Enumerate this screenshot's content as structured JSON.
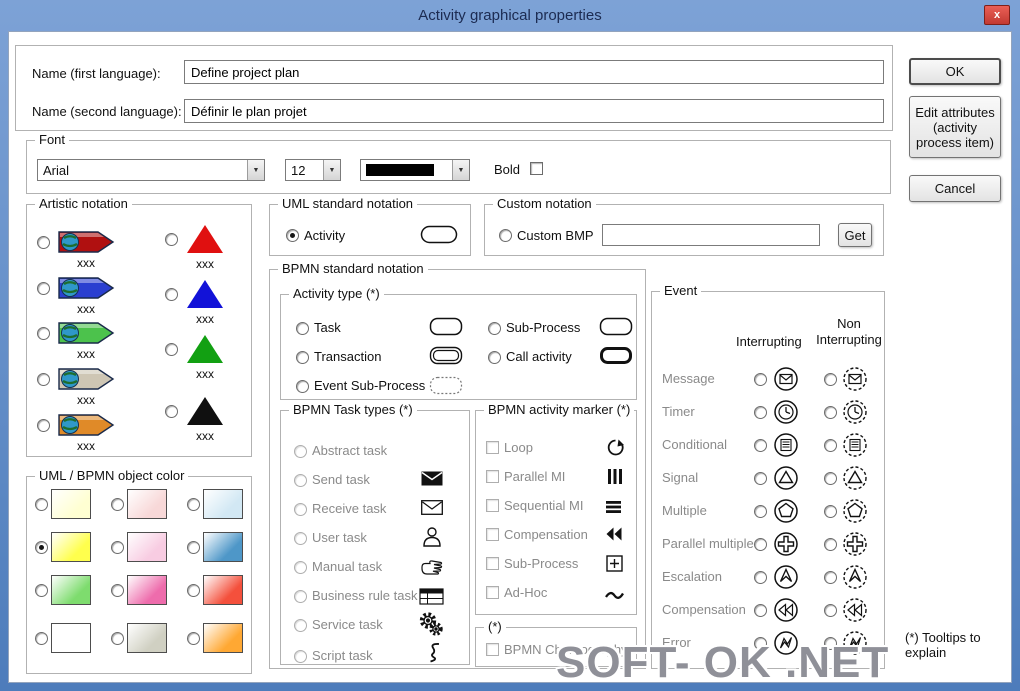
{
  "window": {
    "title": "Activity graphical properties",
    "close": "x"
  },
  "names": {
    "first_label": "Name (first language):",
    "first_value": "Define project plan",
    "second_label": "Name (second language):",
    "second_value": "Définir le plan projet"
  },
  "font": {
    "group": "Font",
    "family": "Arial",
    "size": "12",
    "color": "#000000",
    "bold_label": "Bold"
  },
  "actions": {
    "ok": "OK",
    "edit": "Edit attributes (activity process item)",
    "cancel": "Cancel"
  },
  "artistic": {
    "group": "Artistic notation",
    "arrows": [
      {
        "label": "xxx",
        "color": "#b01010",
        "icon": "globe-arrow-red"
      },
      {
        "label": "xxx",
        "color": "#2a3fd0",
        "icon": "globe-arrow-blue"
      },
      {
        "label": "xxx",
        "color": "#4cc24c",
        "icon": "globe-arrow-green"
      },
      {
        "label": "xxx",
        "color": "#cec6b4",
        "icon": "globe-arrow-tan"
      },
      {
        "label": "xxx",
        "color": "#e08a28",
        "icon": "globe-arrow-orange"
      }
    ],
    "triangles": [
      {
        "label": "xxx",
        "color": "#e01010",
        "icon": "triangle-red"
      },
      {
        "label": "xxx",
        "color": "#1212d8",
        "icon": "triangle-blue"
      },
      {
        "label": "xxx",
        "color": "#12a012",
        "icon": "triangle-green"
      },
      {
        "label": "xxx",
        "color": "#101010",
        "icon": "triangle-black"
      }
    ]
  },
  "object_color": {
    "group": "UML / BPMN object color",
    "selected_index": 3,
    "swatches": [
      "#ffffd2",
      "#f8d8d8",
      "#d2e8f4",
      "#ffff4d",
      "#f8cce2",
      "#4e97c8",
      "#7edc6e",
      "#ee6cac",
      "#f4503c",
      "#ffffff",
      "#d0d0c2",
      "#ffa833"
    ]
  },
  "uml": {
    "group": "UML standard notation",
    "activity_label": "Activity"
  },
  "custom": {
    "group": "Custom notation",
    "bmp_label": "Custom BMP",
    "bmp_value": "",
    "get_label": "Get"
  },
  "bpmn": {
    "group": "BPMN standard notation",
    "activity_type": {
      "group": "Activity type (*)",
      "left": [
        "Task",
        "Transaction",
        "Event Sub-Process"
      ],
      "right": [
        "Sub-Process",
        "Call activity"
      ]
    },
    "task_types": {
      "group": "BPMN Task types (*)",
      "items": [
        {
          "label": "Abstract task",
          "icon": "none"
        },
        {
          "label": "Send task",
          "icon": "envelope-filled"
        },
        {
          "label": "Receive task",
          "icon": "envelope-outline"
        },
        {
          "label": "User task",
          "icon": "person"
        },
        {
          "label": "Manual task",
          "icon": "hand"
        },
        {
          "label": "Business rule task",
          "icon": "table"
        },
        {
          "label": "Service task",
          "icon": "gears"
        },
        {
          "label": "Script task",
          "icon": "script"
        }
      ]
    },
    "markers": {
      "group": "BPMN activity marker (*)",
      "items": [
        {
          "label": "Loop",
          "icon": "loop-arrow"
        },
        {
          "label": "Parallel MI",
          "icon": "vertical-bars"
        },
        {
          "label": "Sequential MI",
          "icon": "horizontal-bars"
        },
        {
          "label": "Compensation",
          "icon": "rewind"
        },
        {
          "label": "Sub-Process",
          "icon": "boxed-plus"
        },
        {
          "label": "Ad-Hoc",
          "icon": "wave"
        }
      ]
    },
    "choreography": {
      "group": "(*)",
      "label": "BPMN Choreography?"
    }
  },
  "event": {
    "group": "Event",
    "columns": {
      "interrupting": "Interrupting",
      "non_interrupting": "Non Interrupting"
    },
    "rows": [
      {
        "label": "Message",
        "icon": "envelope"
      },
      {
        "label": "Timer",
        "icon": "clock"
      },
      {
        "label": "Conditional",
        "icon": "lined-page"
      },
      {
        "label": "Signal",
        "icon": "triangle"
      },
      {
        "label": "Multiple",
        "icon": "pentagon"
      },
      {
        "label": "Parallel multiple",
        "icon": "plus"
      },
      {
        "label": "Escalation",
        "icon": "escalation-arrow"
      },
      {
        "label": "Compensation",
        "icon": "rewind"
      },
      {
        "label": "Error",
        "icon": "lightning"
      }
    ]
  },
  "footnote": "(*) Tooltips to explain",
  "watermark": "SOFT- OK .NET"
}
